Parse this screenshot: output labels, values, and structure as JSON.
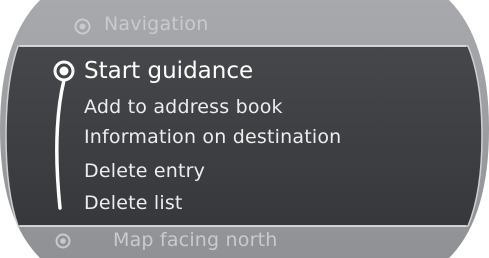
{
  "header": {
    "icon": "navigation-target-icon",
    "title": "Navigation"
  },
  "menu": {
    "items": [
      {
        "label": "Start guidance",
        "selected": true
      },
      {
        "label": "Add to address book",
        "selected": false
      },
      {
        "label": "Information on destination",
        "selected": false
      },
      {
        "label": "Delete entry",
        "selected": false
      },
      {
        "label": "Delete list",
        "selected": false
      }
    ]
  },
  "footer": {
    "icon": "map-orientation-icon",
    "label": "Map facing north"
  },
  "colors": {
    "panel": "#3f4145",
    "outer": "#9d9fa3",
    "text": "#eceded",
    "muted_text": "#c9cacc"
  }
}
